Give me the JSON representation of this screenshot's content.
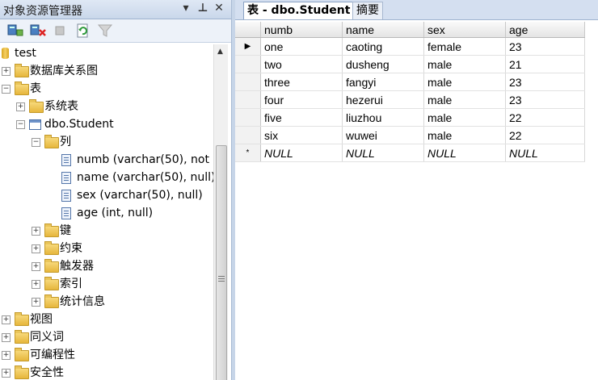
{
  "object_explorer": {
    "title": "对象资源管理器",
    "pin": "ᵖ",
    "close": "✕",
    "dropdown": "▾"
  },
  "tree": [
    {
      "label": "test",
      "icon": "database-icon",
      "expander": "",
      "level": 0
    },
    {
      "label": "数据库关系图",
      "icon": "folder-icon",
      "expander": "+",
      "level": 0
    },
    {
      "label": "表",
      "icon": "folder-icon",
      "expander": "−",
      "level": 0
    },
    {
      "label": "系统表",
      "icon": "folder-icon",
      "expander": "+",
      "level": 1
    },
    {
      "label": "dbo.Student",
      "icon": "table-icon",
      "expander": "−",
      "level": 1
    },
    {
      "label": "列",
      "icon": "folder-icon",
      "expander": "−",
      "level": 2
    },
    {
      "label": "numb (varchar(50), not",
      "icon": "column-icon",
      "expander": "",
      "level": 3
    },
    {
      "label": "name (varchar(50), null)",
      "icon": "column-icon",
      "expander": "",
      "level": 3
    },
    {
      "label": "sex (varchar(50), null)",
      "icon": "column-icon",
      "expander": "",
      "level": 3
    },
    {
      "label": "age (int, null)",
      "icon": "column-icon",
      "expander": "",
      "level": 3
    },
    {
      "label": "键",
      "icon": "folder-icon",
      "expander": "+",
      "level": 2
    },
    {
      "label": "约束",
      "icon": "folder-icon",
      "expander": "+",
      "level": 2
    },
    {
      "label": "触发器",
      "icon": "folder-icon",
      "expander": "+",
      "level": 2
    },
    {
      "label": "索引",
      "icon": "folder-icon",
      "expander": "+",
      "level": 2
    },
    {
      "label": "统计信息",
      "icon": "folder-icon",
      "expander": "+",
      "level": 2
    },
    {
      "label": "视图",
      "icon": "folder-icon",
      "expander": "+",
      "level": 0
    },
    {
      "label": "同义词",
      "icon": "folder-icon",
      "expander": "+",
      "level": 0
    },
    {
      "label": "可编程性",
      "icon": "folder-icon",
      "expander": "+",
      "level": 0
    },
    {
      "label": "安全性",
      "icon": "folder-icon",
      "expander": "+",
      "level": 0
    }
  ],
  "tabs": [
    {
      "label": "表 - dbo.Student",
      "active": true
    },
    {
      "label": "摘要",
      "active": false
    }
  ],
  "grid": {
    "columns": [
      "numb",
      "name",
      "sex",
      "age"
    ],
    "rows": [
      [
        "one",
        "caoting",
        "female",
        "23"
      ],
      [
        "two",
        "dusheng",
        "male",
        "21"
      ],
      [
        "three",
        "fangyi",
        "male",
        "23"
      ],
      [
        "four",
        "hezerui",
        "male",
        "23"
      ],
      [
        "five",
        "liuzhou",
        "male",
        "22"
      ],
      [
        "six",
        "wuwei",
        "male",
        "22"
      ]
    ],
    "new_row": [
      "NULL",
      "NULL",
      "NULL",
      "NULL"
    ],
    "current_marker": "▶",
    "new_marker": "*"
  }
}
